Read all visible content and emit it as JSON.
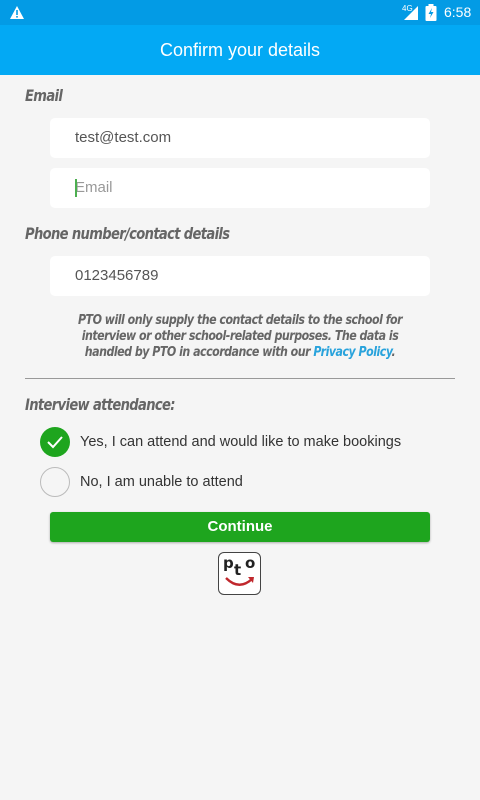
{
  "status_bar": {
    "network": "4G",
    "time": "6:58"
  },
  "header": {
    "title": "Confirm your details"
  },
  "email_section": {
    "label": "Email",
    "email_value": "test@test.com",
    "confirm_placeholder": "Email"
  },
  "phone_section": {
    "label": "Phone number/contact details",
    "phone_value": "0123456789"
  },
  "notice": {
    "text_before": "PTO will only supply the contact details to the school for interview or other school-related purposes. The data is handled by PTO in accordance with our ",
    "link": "Privacy Policy",
    "text_after": "."
  },
  "attendance": {
    "label": "Interview attendance:",
    "options": [
      {
        "label": "Yes, I can attend and would like to make bookings",
        "selected": true
      },
      {
        "label": "No, I am unable to attend",
        "selected": false
      }
    ]
  },
  "continue_label": "Continue",
  "logo": {
    "p": "p",
    "t": "t",
    "o": "o"
  },
  "colors": {
    "header": "#03a9f4",
    "status_bar": "#039be5",
    "accent_green": "#1ea51e",
    "link": "#29a3dc"
  }
}
